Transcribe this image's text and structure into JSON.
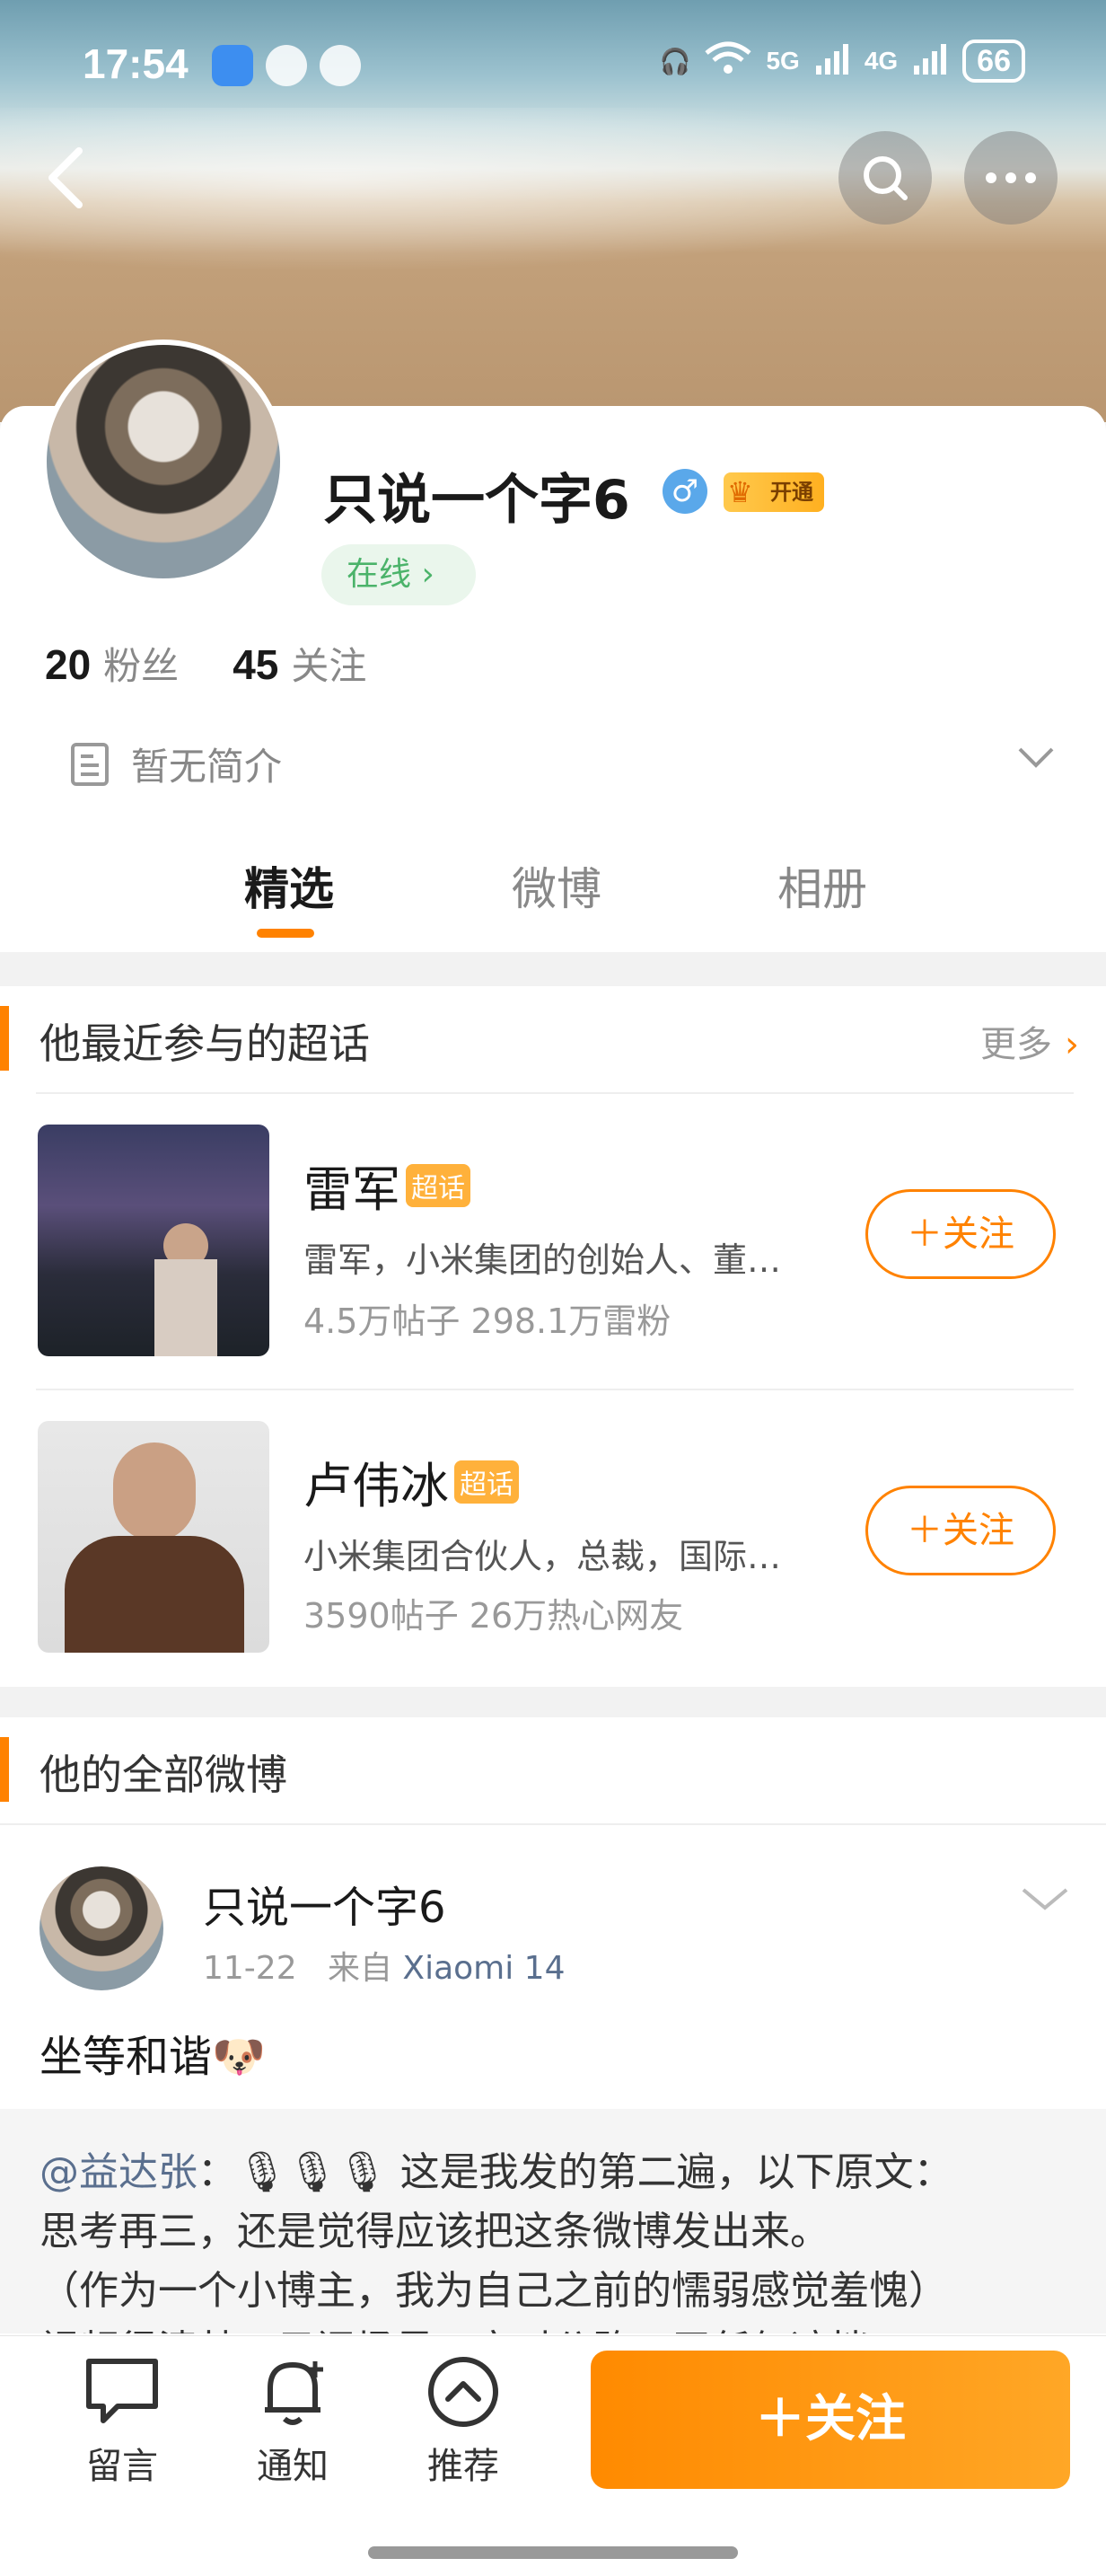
{
  "status_bar": {
    "time": "17:54",
    "network1": "5G",
    "network2": "4G",
    "battery": "66"
  },
  "profile": {
    "username": "只说一个字6",
    "gender_symbol": "♂",
    "vip_label": "开通",
    "online_label": "在线 ›",
    "fans_count": "20",
    "fans_label": "粉丝",
    "following_count": "45",
    "following_label": "关注",
    "bio": "暂无简介"
  },
  "tabs": [
    {
      "label": "精选",
      "active": true
    },
    {
      "label": "微博",
      "active": false
    },
    {
      "label": "相册",
      "active": false
    }
  ],
  "super_topics": {
    "title": "他最近参与的超话",
    "more_label": "更多",
    "badge": "超话",
    "items": [
      {
        "name": "雷军",
        "desc": "雷军，小米集团的创始人、董…",
        "stats": "4.5万帖子 298.1万雷粉",
        "follow_label": "＋关注"
      },
      {
        "name": "卢伟冰",
        "desc": "小米集团合伙人，总裁，国际…",
        "stats": "3590帖子 26万热心网友",
        "follow_label": "＋关注"
      }
    ]
  },
  "weibo_section": {
    "title": "他的全部微博",
    "post": {
      "user": "只说一个字6",
      "date": "11-22",
      "source_prefix": "来自",
      "source": "Xiaomi 14",
      "text": "坐等和谐🐶",
      "repost_mention": "@益达张",
      "repost_lines": [
        "：🎙🎙🎙 这是我发的第二遍，以下原文：",
        "思考再三，还是觉得应该把这条微博发出来。",
        "（作为一个小博主，我为自己之前的懦弱感觉羞愧）",
        "视频很清楚，只问场景，实时公路，无任何遮挡"
      ]
    }
  },
  "bottom_bar": {
    "comment": "留言",
    "notify": "通知",
    "recommend": "推荐",
    "follow": "＋关注"
  },
  "colors": {
    "accent": "#ff8200",
    "link": "#5a6f8e",
    "online_green": "#4bb36a"
  }
}
